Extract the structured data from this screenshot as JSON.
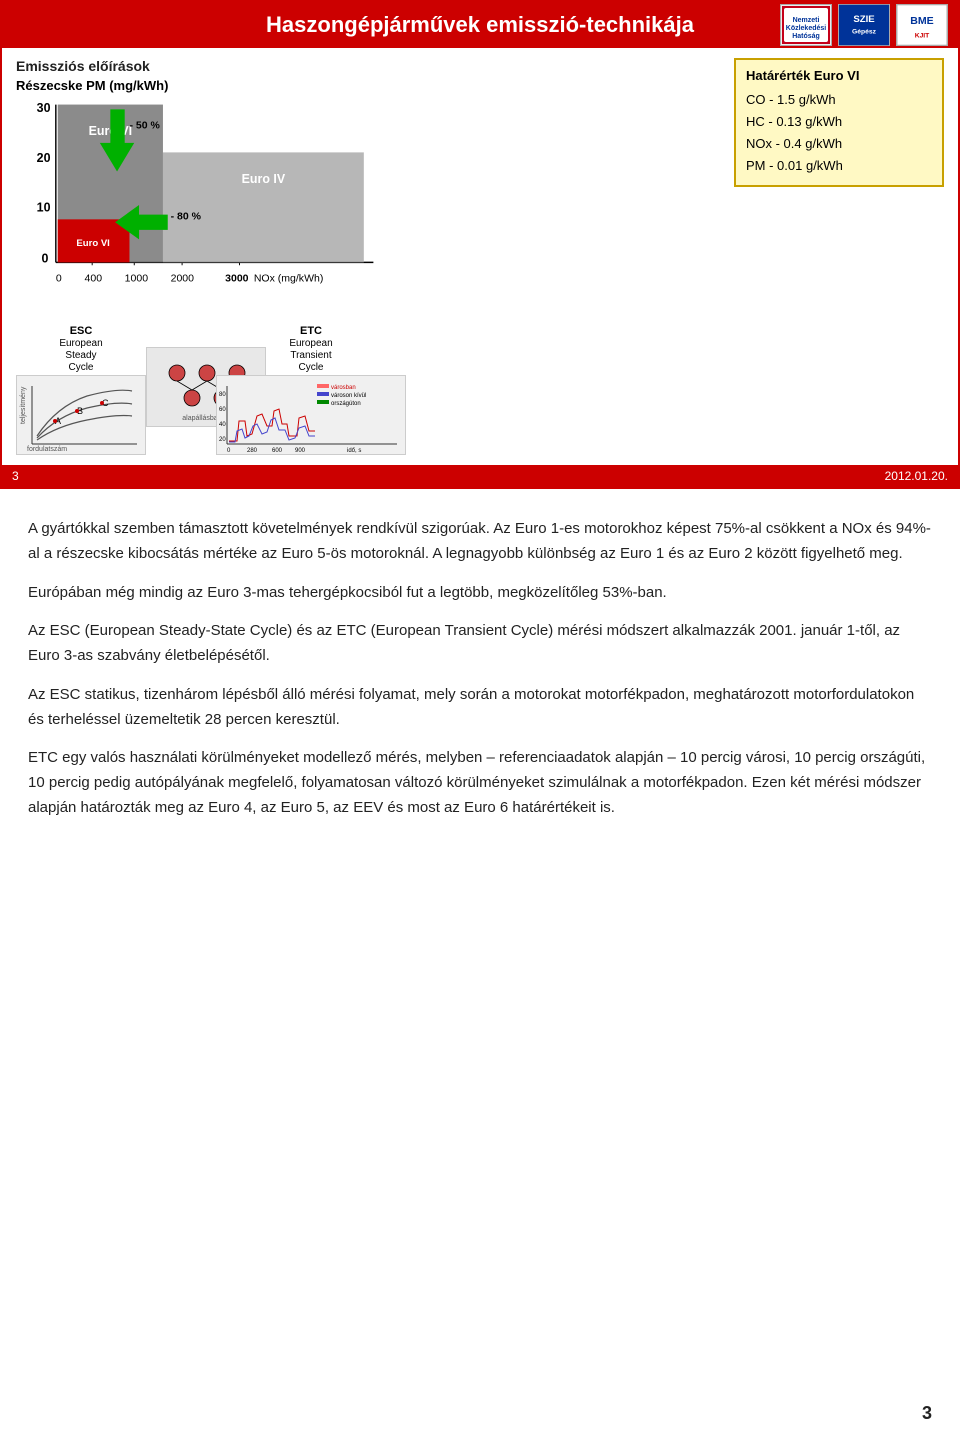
{
  "slide": {
    "header_title": "Haszongépjárművek emisszió-technikája",
    "logos": [
      "NKH",
      "BME"
    ],
    "emissions_section_title": "Emissziós előírások",
    "pm_label": "Részecske PM (mg/kWh)",
    "y_axis_labels": [
      "30",
      "20",
      "10",
      "0"
    ],
    "x_axis_labels": [
      "0",
      "400",
      "1000",
      "2000",
      "3000"
    ],
    "x_axis_unit": "NOx (mg/kWh)",
    "bar_euro_vi_label": "Euro VI",
    "bar_euro_iv_label": "Euro IV",
    "bar_euro_vi_bottom_label": "Euro VI",
    "arrow_50_label": "- 50 %",
    "arrow_80_label": "- 80 %",
    "hatarErtek_title": "Határérték Euro VI",
    "hatarErtek_rows": [
      "CO  -  1.5 g/kWh",
      "HC  -  0.13 g/kWh",
      "NOx -  0.4 g/kWh",
      "PM  -  0.01 g/kWh"
    ],
    "esc_label": "ESC",
    "esc_full": "European\nSteady\nCycle",
    "etc_label": "ETC",
    "etc_full": "European\nTransient\nCycle",
    "footer_page": "3",
    "footer_date": "2012.01.20."
  },
  "text_paragraphs": [
    "A gyártókkal szemben támasztott követelmények rendkívül szigorúak. Az Euro 1-es motorokhoz képest 75%-al csökkent a NOx és 94%-al a részecske kibocsátás mértéke az Euro 5-ös motoroknál. A legnagyobb különbség az Euro 1 és az Euro 2 között figyelhető meg.",
    "Európában még mindig az Euro 3-mas tehergépkocsiból fut a legtöbb, megközelítőleg 53%-ban.",
    "Az ESC (European Steady-State Cycle) és az ETC (European Transient Cycle) mérési módszert alkalmazzák 2001. január 1-től, az Euro 3-as szabvány életbelépésétől.",
    "Az ESC statikus, tizenhárom lépésből álló mérési folyamat, mely során a motorokat motorfékpadon, meghatározott motorfordulatokon és terheléssel üzemeltetik 28 percen keresztül.",
    "ETC egy valós használati körülményeket modellező mérés, melyben – referenciaadatok alapján – 10 percig városi, 10 percig országúti, 10 percig pedig autópályának megfelelő, folyamatosan változó körülményeket szimulálnak a motorfékpadon. Ezen két mérési módszer alapján határozták meg az Euro 4, az Euro 5, az EEV és most az Euro 6 határértékeit is."
  ],
  "page_number": "3"
}
